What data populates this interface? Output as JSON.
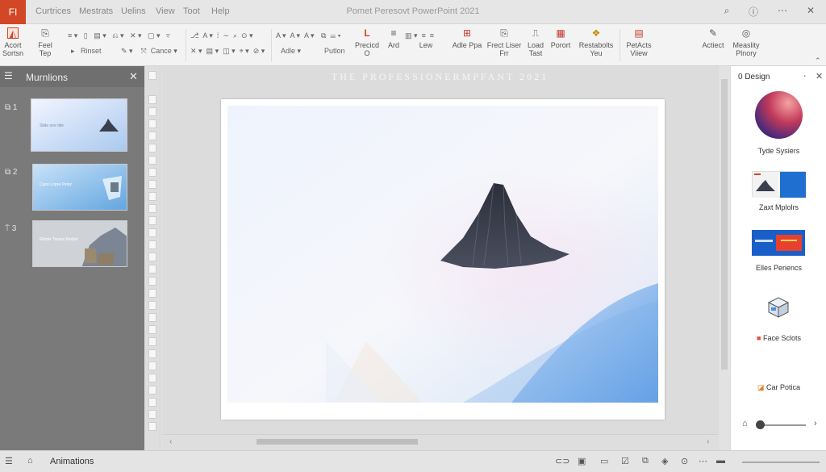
{
  "app": {
    "badge": "FI",
    "title": "Pomet Peresovt PowerPoint 2021"
  },
  "menu": [
    "Curtrices",
    "Mestrats",
    "Uelins",
    "View",
    "Toot",
    "Help"
  ],
  "window_controls": {
    "search": "⌕",
    "info": "ⓘ",
    "more": "⋯",
    "close": "✕"
  },
  "ribbon": {
    "big": [
      {
        "label": "Acort Sortsn",
        "icon": "warning-icon",
        "glyph": "◭"
      },
      {
        "label": "Feel Tep",
        "icon": "clipboard-icon",
        "glyph": "⎘"
      },
      {
        "label": "Precicd O",
        "icon": "shape-l-icon",
        "glyph": "L"
      },
      {
        "label": "Ard",
        "icon": "align-icon",
        "glyph": "≡"
      },
      {
        "label": "Lew",
        "icon": "list-icon",
        "glyph": "≡"
      },
      {
        "label": "Adle Ppa",
        "icon": "new-slide-icon",
        "glyph": "⊞"
      },
      {
        "label": "Frect Liser Frr",
        "icon": "copy-icon",
        "glyph": "⎘"
      },
      {
        "label": "Load Tast",
        "icon": "bookmark-icon",
        "glyph": "⎍"
      },
      {
        "label": "Porort",
        "icon": "table-icon",
        "glyph": "▦"
      },
      {
        "label": "Restabolts Yeu",
        "icon": "shapes-icon",
        "glyph": "❖"
      },
      {
        "label": "PetActs Viiew",
        "icon": "slides-icon",
        "glyph": "▤"
      },
      {
        "label": "Actiect",
        "icon": "pen-icon",
        "glyph": "✎"
      },
      {
        "label": "Measlity Plnory",
        "icon": "globe-icon",
        "glyph": "◎"
      }
    ],
    "small": {
      "rinset": "Rinset",
      "cance": "Cance",
      "adle": "Adle",
      "putlon": "Putlon"
    }
  },
  "left_pane": {
    "title": "Murnlions",
    "slides": [
      {
        "num": "1",
        "caption": "Slide one title"
      },
      {
        "num": "2",
        "caption": "Cano Lnpre Peloz"
      },
      {
        "num": "3",
        "caption": "Retole Treans Redod"
      }
    ]
  },
  "slide": {
    "heading": "THE PROFESSIONERMPFANT 2021"
  },
  "right_pane": {
    "title": "0 Design",
    "items": [
      {
        "label": "Tyde Sysiers",
        "icon": "color-sphere-icon"
      },
      {
        "label": "Zaxt Mplolrs",
        "icon": "template-icon"
      },
      {
        "label": "Elles Periencs",
        "icon": "theme-icon"
      },
      {
        "label": "Face Sclots",
        "icon": "box-icon"
      },
      {
        "label": "Car Potica",
        "icon": "palette-icon"
      }
    ]
  },
  "status": {
    "label": "Animations"
  },
  "colors": {
    "accent": "#d24726",
    "sky_blue": "#4a90e2",
    "mountain": "#3b3f4c"
  }
}
